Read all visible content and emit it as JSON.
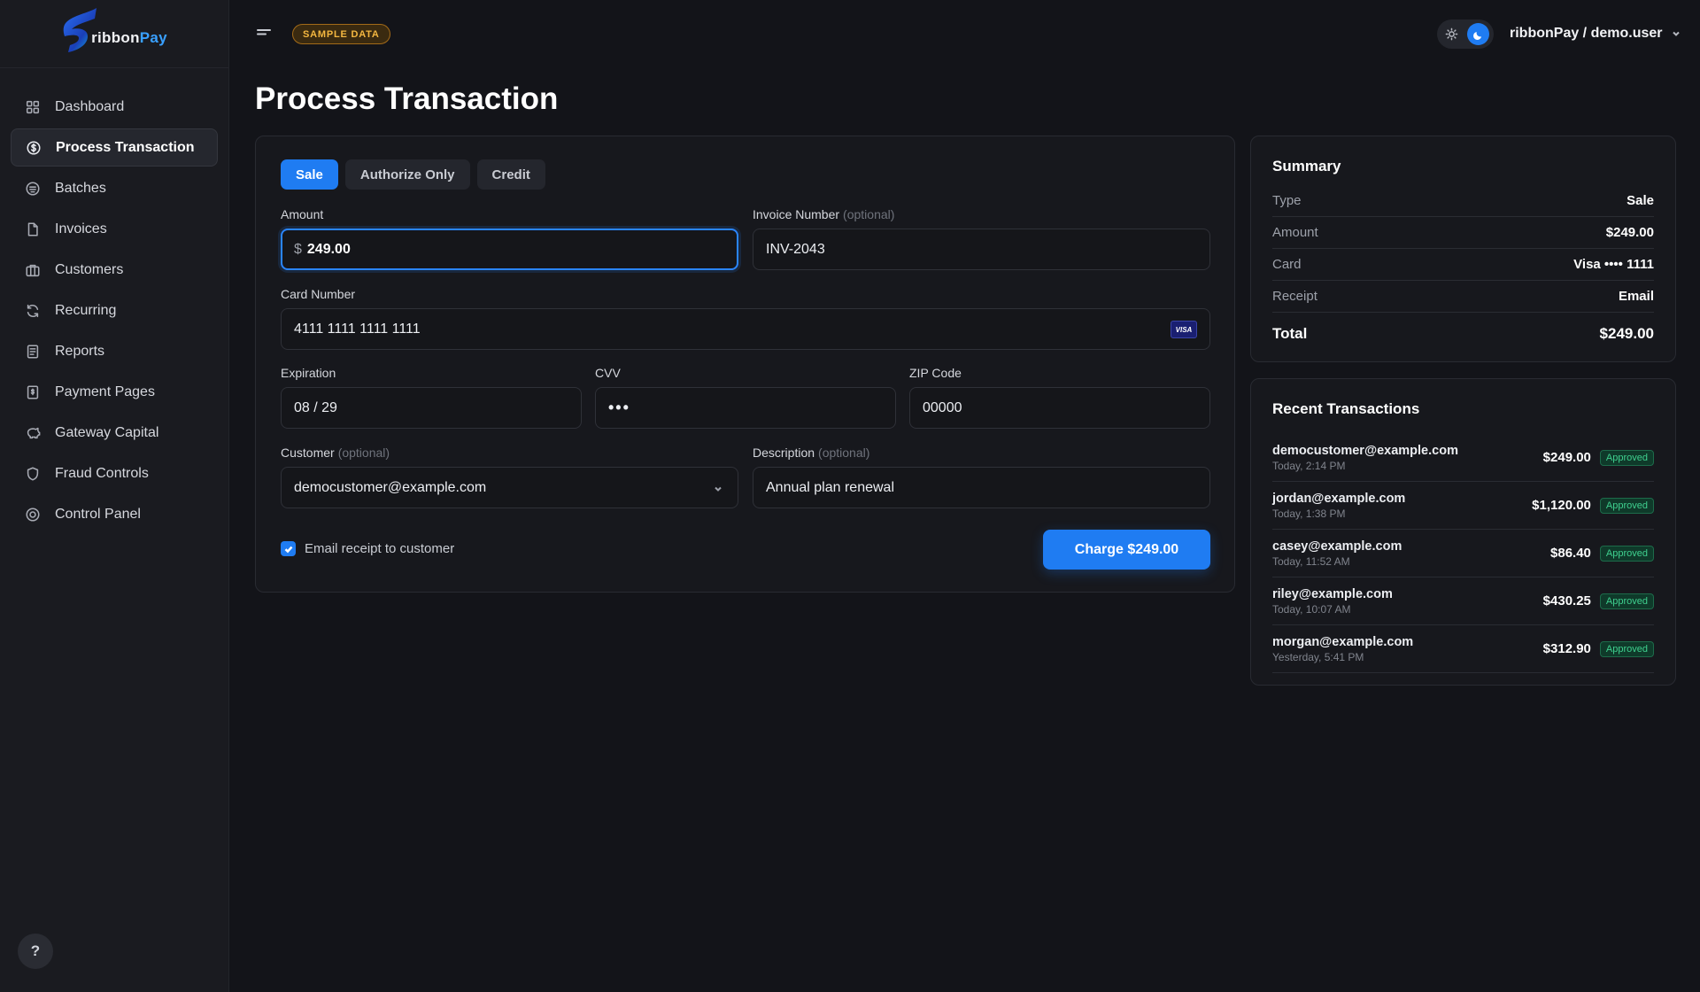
{
  "brand": {
    "name_part1": "ribbon",
    "name_part2": "Pay",
    "accent": "#1f7cf2"
  },
  "sidebar": {
    "items": [
      {
        "label": "Dashboard",
        "icon": "grid-icon"
      },
      {
        "label": "Process Transaction",
        "icon": "dollar-circle-icon",
        "active": true
      },
      {
        "label": "Batches",
        "icon": "stack-circle-icon"
      },
      {
        "label": "Invoices",
        "icon": "document-icon"
      },
      {
        "label": "Customers",
        "icon": "briefcase-icon"
      },
      {
        "label": "Recurring",
        "icon": "refresh-icon"
      },
      {
        "label": "Reports",
        "icon": "report-icon"
      },
      {
        "label": "Payment Pages",
        "icon": "payment-page-icon"
      },
      {
        "label": "Gateway Capital",
        "icon": "piggy-bank-icon"
      },
      {
        "label": "Fraud Controls",
        "icon": "shield-icon"
      },
      {
        "label": "Control Panel",
        "icon": "target-icon"
      }
    ],
    "help_label": "?"
  },
  "topbar": {
    "badge": "SAMPLE DATA",
    "account": "ribbonPay / demo.user"
  },
  "page": {
    "title": "Process Transaction"
  },
  "form": {
    "tabs": [
      "Sale",
      "Authorize Only",
      "Credit"
    ],
    "active_tab": "Sale",
    "amount": {
      "label": "Amount",
      "prefix": "$",
      "value": "249.00"
    },
    "invoice": {
      "label": "Invoice Number",
      "optional": "(optional)",
      "value": "INV-2043"
    },
    "card": {
      "label": "Card Number",
      "value": "4111 1111 1111 1111",
      "brand": "VISA"
    },
    "expiration": {
      "label": "Expiration",
      "value": "08 / 29"
    },
    "cvv": {
      "label": "CVV",
      "value": "•••"
    },
    "zip": {
      "label": "ZIP Code",
      "value": "00000"
    },
    "customer": {
      "label": "Customer",
      "optional": "(optional)",
      "value": "democustomer@example.com"
    },
    "description": {
      "label": "Description",
      "optional": "(optional)",
      "value": "Annual plan renewal"
    },
    "email_receipt": {
      "label": "Email receipt to customer",
      "checked": true
    },
    "charge_button": "Charge $249.00"
  },
  "summary": {
    "title": "Summary",
    "rows": [
      {
        "key": "Type",
        "value": "Sale"
      },
      {
        "key": "Amount",
        "value": "$249.00"
      },
      {
        "key": "Card",
        "value": "Visa •••• 1111"
      },
      {
        "key": "Receipt",
        "value": "Email"
      }
    ],
    "total_label": "Total",
    "total_value": "$249.00"
  },
  "recent": {
    "title": "Recent Transactions",
    "items": [
      {
        "email": "democustomer@example.com",
        "time": "Today, 2:14 PM",
        "amount": "$249.00",
        "status": "Approved"
      },
      {
        "email": "jordan@example.com",
        "time": "Today, 1:38 PM",
        "amount": "$1,120.00",
        "status": "Approved"
      },
      {
        "email": "casey@example.com",
        "time": "Today, 11:52 AM",
        "amount": "$86.40",
        "status": "Approved"
      },
      {
        "email": "riley@example.com",
        "time": "Today, 10:07 AM",
        "amount": "$430.25",
        "status": "Approved"
      },
      {
        "email": "morgan@example.com",
        "time": "Yesterday, 5:41 PM",
        "amount": "$312.90",
        "status": "Approved"
      }
    ]
  }
}
